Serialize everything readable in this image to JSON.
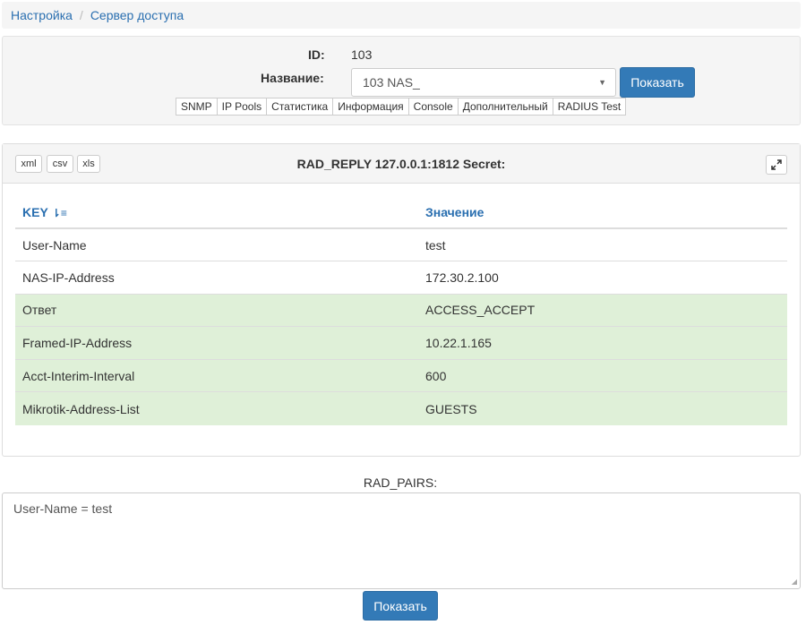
{
  "breadcrumb": {
    "items": [
      "Настройка",
      "Сервер доступа"
    ]
  },
  "form": {
    "id_label": "ID:",
    "id_value": "103",
    "name_label": "Название:",
    "name_value": "103 NAS_",
    "show_button": "Показать",
    "tabs": [
      "SNMP",
      "IP Pools",
      "Статистика",
      "Информация",
      "Console",
      "Дополнительный",
      "RADIUS Test"
    ]
  },
  "result": {
    "export_buttons": [
      "xml",
      "csv",
      "xls"
    ],
    "title": "RAD_REPLY 127.0.0.1:1812 Secret:",
    "columns": [
      "KEY",
      "Значение"
    ],
    "rows": [
      {
        "key": "User-Name",
        "value": "test",
        "status": "normal"
      },
      {
        "key": "NAS-IP-Address",
        "value": "172.30.2.100",
        "status": "normal"
      },
      {
        "key": "Ответ",
        "value": "ACCESS_ACCEPT",
        "status": "success"
      },
      {
        "key": "Framed-IP-Address",
        "value": "10.22.1.165",
        "status": "success"
      },
      {
        "key": "Acct-Interim-Interval",
        "value": "600",
        "status": "success"
      },
      {
        "key": "Mikrotik-Address-List",
        "value": "GUESTS",
        "status": "success"
      }
    ]
  },
  "pairs": {
    "label": "RAD_PAIRS:",
    "value": "User-Name = test",
    "show_button": "Показать"
  },
  "colors": {
    "primary": "#337ab7",
    "success_row": "#dff0d8",
    "link": "#2a6fb0"
  }
}
